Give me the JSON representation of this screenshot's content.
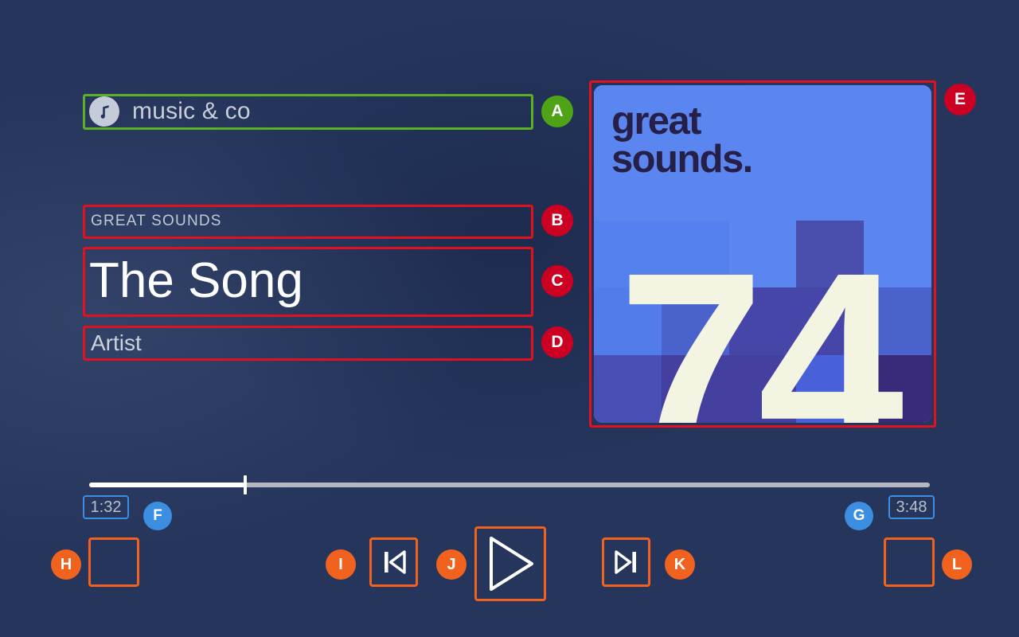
{
  "app": {
    "name": "music & co",
    "icon": "music-note-icon"
  },
  "now_playing": {
    "album_label": "GREAT SOUNDS",
    "title": "The Song",
    "artist": "Artist",
    "album_art": {
      "wordmark_line1": "great",
      "wordmark_line2": "sounds.",
      "number": "74",
      "base_color": "#5c86ef",
      "wordmark_color": "#261f47",
      "number_color": "#f4f4e2",
      "tiles": [
        "#5c86ef",
        "#5c86ef",
        "#5c86ef",
        "#5c86ef",
        "#5c86ef",
        "#5c86ef",
        "#5c86ef",
        "#5c86ef",
        "#5c86ef",
        "#5c86ef",
        "#5481ee",
        "#5481ee",
        "#5c86ef",
        "#4a4fae",
        "#5c86ef",
        "#517cea",
        "#4a62cc",
        "#4646a8",
        "#4646a8",
        "#4a62cc",
        "#4a4fb5",
        "#4340a0",
        "#4340a0",
        "#4860d8",
        "#3a2a7a"
      ]
    }
  },
  "player": {
    "time_current": "1:32",
    "time_total": "3:48",
    "progress_percent": 18.6,
    "controls": [
      {
        "name": "shuffle-button",
        "icon": "blank-icon"
      },
      {
        "name": "previous-track-button",
        "icon": "skip-previous-icon"
      },
      {
        "name": "play-button",
        "icon": "play-icon"
      },
      {
        "name": "next-track-button",
        "icon": "skip-next-icon"
      },
      {
        "name": "repeat-button",
        "icon": "blank-icon"
      }
    ]
  },
  "annotations": {
    "colors": {
      "green": "#5bb024",
      "red": "#e0121f",
      "orange": "#f2621f",
      "blue": "#3c8ee0",
      "badge_green": "#4fa316",
      "badge_red": "#cc0022",
      "badge_orange": "#f2621f",
      "badge_blue": "#3c8ee0"
    },
    "items": [
      {
        "label": "A",
        "target": "app-name-field",
        "style": "green"
      },
      {
        "label": "B",
        "target": "album-label-field",
        "style": "red"
      },
      {
        "label": "C",
        "target": "track-title-field",
        "style": "red"
      },
      {
        "label": "D",
        "target": "artist-name-field",
        "style": "red"
      },
      {
        "label": "E",
        "target": "album-art",
        "style": "red"
      },
      {
        "label": "F",
        "target": "current-time",
        "style": "blue"
      },
      {
        "label": "G",
        "target": "total-time",
        "style": "blue"
      },
      {
        "label": "H",
        "target": "shuffle-button",
        "style": "orange"
      },
      {
        "label": "I",
        "target": "previous-track-button",
        "style": "orange"
      },
      {
        "label": "J",
        "target": "play-button",
        "style": "orange"
      },
      {
        "label": "K",
        "target": "next-track-button",
        "style": "orange"
      },
      {
        "label": "L",
        "target": "repeat-button",
        "style": "orange"
      }
    ]
  }
}
